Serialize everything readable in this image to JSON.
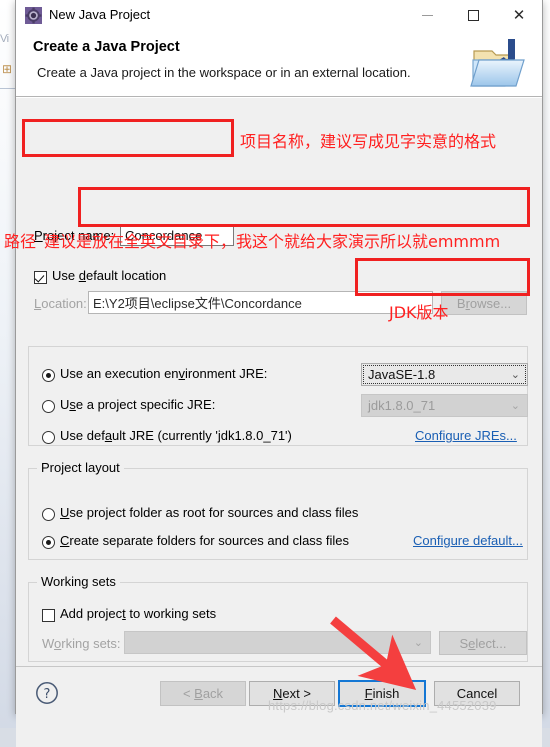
{
  "window": {
    "title": "New Java Project",
    "icon": "eclipse-wizard-gear-icon",
    "minimize_label": "minimize",
    "maximize_label": "maximize",
    "close_label": "close"
  },
  "header": {
    "title": "Create a Java Project",
    "subtitle": "Create a Java project in the workspace or in an external location.",
    "banner_icon": "java-project-folder-icon"
  },
  "form": {
    "project_name_label": "Project name:",
    "project_name_value": "Concordance",
    "use_default_location_label": "Use default location",
    "use_default_location_checked": true,
    "location_label": "Location:",
    "location_value": "E:\\Y2项目\\eclipse文件\\Concordance",
    "browse_label": "Browse...",
    "jre": {
      "exec_env_label": "Use an execution environment JRE:",
      "exec_env_selected": true,
      "exec_env_value": "JavaSE-1.8",
      "project_specific_label": "Use a project specific JRE:",
      "project_specific_selected": false,
      "project_specific_value": "jdk1.8.0_71",
      "default_jre_label": "Use default JRE (currently 'jdk1.8.0_71')",
      "default_jre_selected": false,
      "configure_jres_link": "Configure JREs..."
    },
    "project_layout": {
      "group_title": "Project layout",
      "option_root_label": "Use project folder as root for sources and class files",
      "option_root_selected": false,
      "option_separate_label": "Create separate folders for sources and class files",
      "option_separate_selected": true,
      "configure_default_link": "Configure default..."
    },
    "working_sets": {
      "group_title": "Working sets",
      "add_project_label": "Add project to working sets",
      "add_project_checked": false,
      "working_sets_label": "Working sets:",
      "working_sets_value": "",
      "select_label": "Select..."
    }
  },
  "footer": {
    "help_icon": "help-question-icon",
    "back_label": "< Back",
    "back_disabled": true,
    "next_label": "Next >",
    "finish_label": "Finish",
    "cancel_label": "Cancel"
  },
  "annotations": {
    "color": "#ff2020",
    "project_name_note": "项目名称，建议写成见字实意的格式",
    "path_label_note": "路径",
    "path_note": "建议是放在全英文目录下，我这个就给大家演示所以就emmmm",
    "jdk_note": "JDK版本",
    "arrow_target": "finish-button"
  },
  "watermark": {
    "text": "https://blog.csdn.net/weixin_44552039"
  },
  "background": {
    "tab_text": "Vi",
    "tree_glyph": "⊞"
  }
}
